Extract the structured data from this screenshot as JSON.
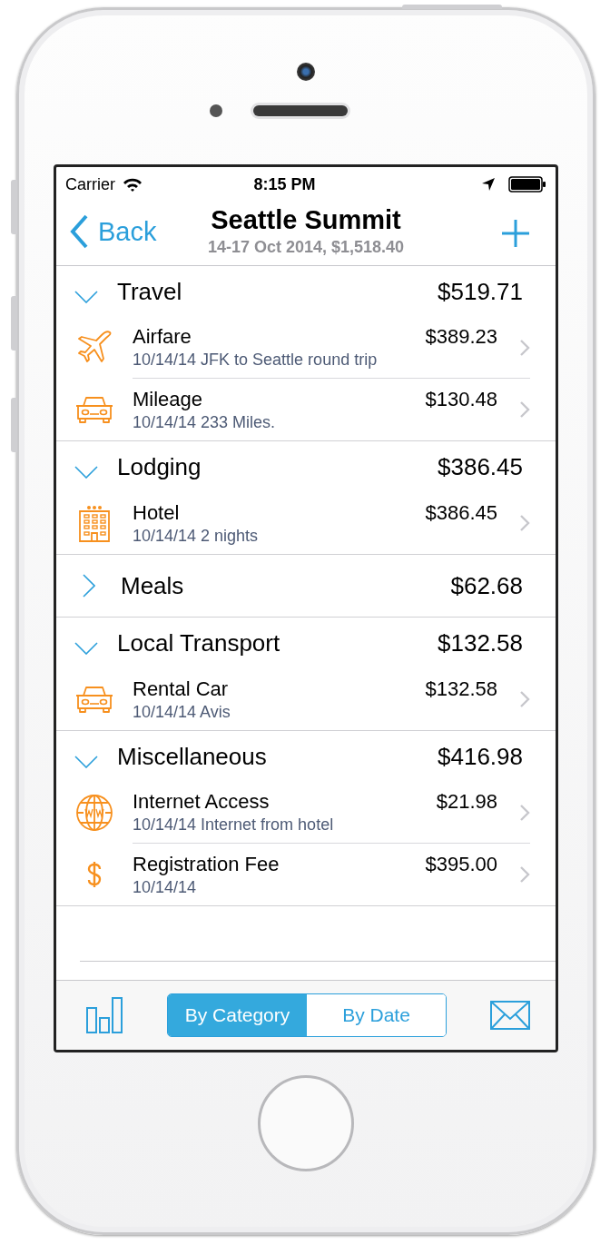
{
  "status_bar": {
    "carrier": "Carrier",
    "time": "8:15 PM"
  },
  "nav": {
    "back": "Back",
    "title": "Seattle Summit",
    "subtitle": "14-17 Oct 2014, $1,518.40"
  },
  "sections": [
    {
      "name": "Travel",
      "total": "$519.71",
      "expanded": true,
      "items": [
        {
          "kind": "plane",
          "title": "Airfare",
          "amount": "$389.23",
          "detail": "10/14/14 JFK to Seattle round trip"
        },
        {
          "kind": "car",
          "title": "Mileage",
          "amount": "$130.48",
          "detail": "10/14/14 233 Miles."
        }
      ]
    },
    {
      "name": "Lodging",
      "total": "$386.45",
      "expanded": true,
      "items": [
        {
          "kind": "hotel",
          "title": "Hotel",
          "amount": "$386.45",
          "detail": "10/14/14 2 nights"
        }
      ]
    },
    {
      "name": "Meals",
      "total": "$62.68",
      "expanded": false
    },
    {
      "name": "Local Transport",
      "total": "$132.58",
      "expanded": true,
      "items": [
        {
          "kind": "car",
          "title": "Rental Car",
          "amount": "$132.58",
          "detail": "10/14/14 Avis"
        }
      ]
    },
    {
      "name": "Miscellaneous",
      "total": "$416.98",
      "expanded": true,
      "items": [
        {
          "kind": "globe",
          "title": "Internet Access",
          "amount": "$21.98",
          "detail": "10/14/14 Internet from hotel"
        },
        {
          "kind": "dollar",
          "title": "Registration Fee",
          "amount": "$395.00",
          "detail": "10/14/14"
        }
      ]
    }
  ],
  "segments": [
    {
      "label": "By Category",
      "selected": true
    },
    {
      "label": "By Date",
      "selected": false
    }
  ]
}
